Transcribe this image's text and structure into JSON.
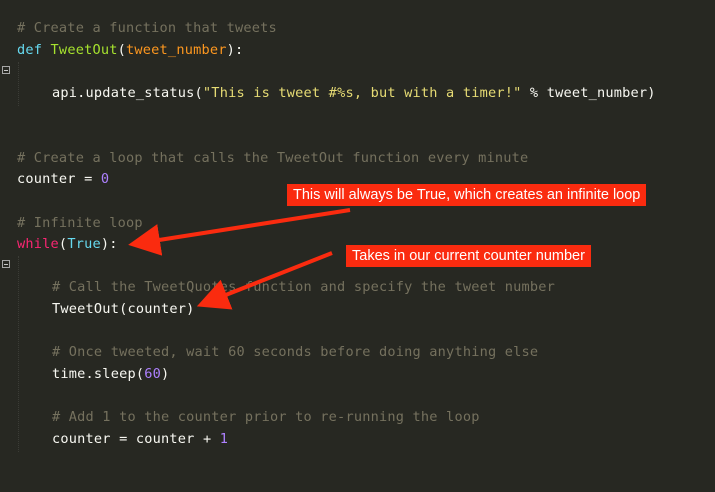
{
  "code": {
    "l1_comment": "# Create a function that tweets",
    "l2_def": "def",
    "l2_name": "TweetOut",
    "l2_open": "(",
    "l2_param": "tweet_number",
    "l2_close": "):",
    "l4_call": "api.update_status(",
    "l4_string": "\"This is tweet #%s, but with a timer!\"",
    "l4_op": " % ",
    "l4_rest": "tweet_number)",
    "l7_comment": "# Create a loop that calls the TweetOut function every minute",
    "l8_var": "counter",
    "l8_eq": " = ",
    "l8_num": "0",
    "l10_comment": "# Infinite loop",
    "l11_while": "while",
    "l11_open": "(",
    "l11_true": "True",
    "l11_close": "):",
    "l13_comment": "# Call the TweetQuotes function and specify the tweet number",
    "l14_call": "TweetOut(counter)",
    "l16_comment": "# Once tweeted, wait 60 seconds before doing anything else",
    "l17_call": "time.sleep(",
    "l17_num": "60",
    "l17_close": ")",
    "l19_comment": "# Add 1 to the counter prior to re-running the loop",
    "l20_lhs": "counter",
    "l20_eq": " = ",
    "l20_mid": "counter",
    "l20_plus": " + ",
    "l20_num": "1"
  },
  "annotations": {
    "infinite_loop": "This will always be True, which creates an infinite loop",
    "counter_number": "Takes in our current counter number"
  },
  "colors": {
    "background": "#272822",
    "comment": "#75715e",
    "keyword": "#66d9ef",
    "function": "#a6e22e",
    "string": "#e6db74",
    "number": "#ae81ff",
    "operator": "#f92672",
    "annotation": "#fa2b0f"
  },
  "icons": {
    "fold_marker": "fold-minus-icon"
  }
}
